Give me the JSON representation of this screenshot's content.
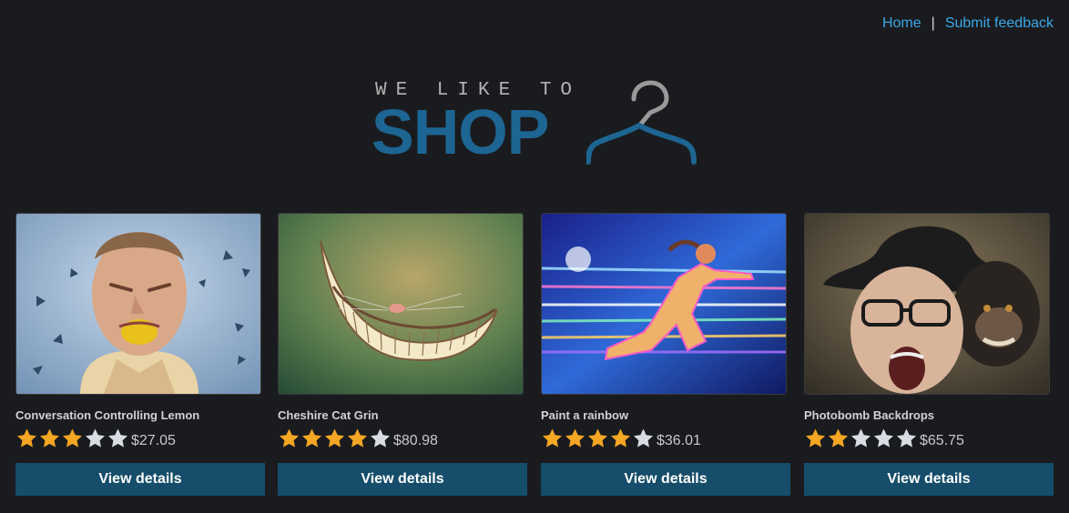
{
  "nav": {
    "home_label": "Home",
    "separator": "|",
    "feedback_label": "Submit feedback"
  },
  "logo": {
    "tagline": "WE LIKE TO",
    "wordmark": "SHOP"
  },
  "colors": {
    "background": "#1a1b1e",
    "link": "#3aa8e8",
    "brand": "#1d6592",
    "button": "#154d6a",
    "star_filled": "#f5a623",
    "star_empty": "#d9dde3"
  },
  "products": [
    {
      "name": "Conversation Controlling Lemon",
      "rating": 3,
      "max_rating": 5,
      "price": "$27.05",
      "button_label": "View details",
      "image": "man-biting-lemon-photo"
    },
    {
      "name": "Cheshire Cat Grin",
      "rating": 4,
      "max_rating": 5,
      "price": "$80.98",
      "button_label": "View details",
      "image": "cheshire-grin-illustration"
    },
    {
      "name": "Paint a rainbow",
      "rating": 4,
      "max_rating": 5,
      "price": "$36.01",
      "button_label": "View details",
      "image": "neon-runner-illustration"
    },
    {
      "name": "Photobomb Backdrops",
      "rating": 2,
      "max_rating": 5,
      "price": "$65.75",
      "button_label": "View details",
      "image": "man-with-monkey-photo"
    }
  ]
}
